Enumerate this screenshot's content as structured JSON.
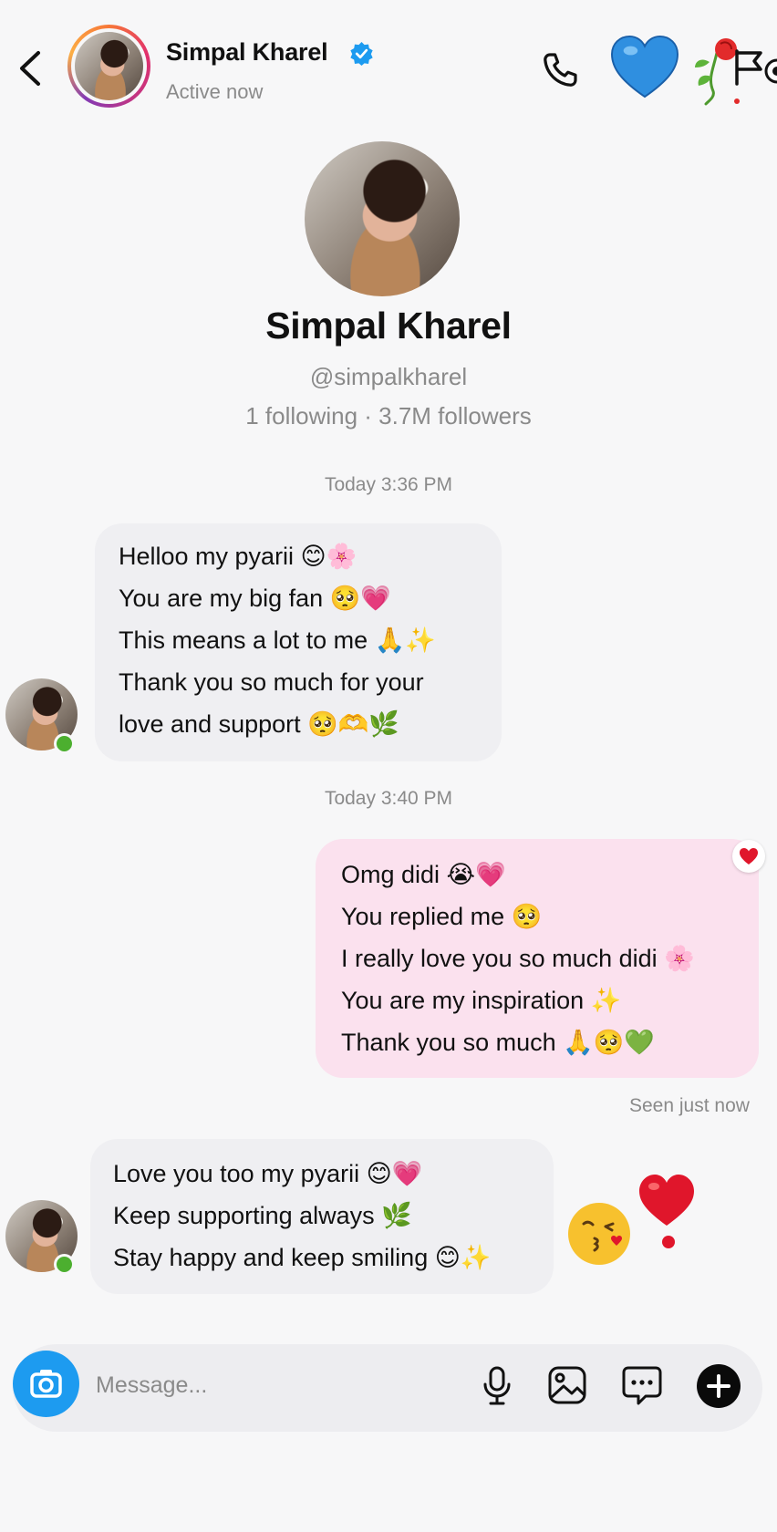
{
  "header": {
    "title": "Simpal Kharel",
    "status": "Active now"
  },
  "profile": {
    "name": "Simpal Kharel",
    "handle": "@simpalkharel",
    "stats": "1 following · 3.7M followers"
  },
  "messages": [
    {
      "timestamp": "Today 3:36 PM",
      "direction": "incoming",
      "lines": [
        "Helloo my pyarii 😊🌸",
        "You are my big fan 🥺💗",
        "This means a lot to me 🙏✨",
        "Thank you so much for your",
        "love and support 🥺🫶🌿"
      ]
    },
    {
      "timestamp": "Today 3:40 PM",
      "direction": "outgoing",
      "lines": [
        "Omg didi 😭💗",
        "You replied me 🥺",
        "I really love you so much didi 🌸",
        "You are my inspiration ✨",
        "Thank you so much 🙏🥺💚"
      ],
      "reaction": "❤️",
      "receipt": "Seen just now"
    },
    {
      "direction": "incoming",
      "lines": [
        "Love you too my pyarii 😊💗",
        "Keep supporting always 🌿",
        "Stay happy and keep smiling 😊✨"
      ],
      "after_emojis": [
        "😘",
        "❣️"
      ]
    }
  ],
  "composer": {
    "placeholder": "Message..."
  },
  "icons": {
    "back": "chevron-left-icon",
    "verified": "verified-badge-icon",
    "call": "phone-icon",
    "camera": "camera-icon",
    "mic": "microphone-icon",
    "gallery": "image-icon",
    "sticker": "chat-bubble-icon",
    "plus": "plus-icon"
  },
  "colors": {
    "verified": "#1d9bf0",
    "camera_button": "#1d9bf0",
    "incoming_bubble": "#efeff2",
    "outgoing_bubble": "#fbe1ee",
    "online": "#4caf2f"
  }
}
